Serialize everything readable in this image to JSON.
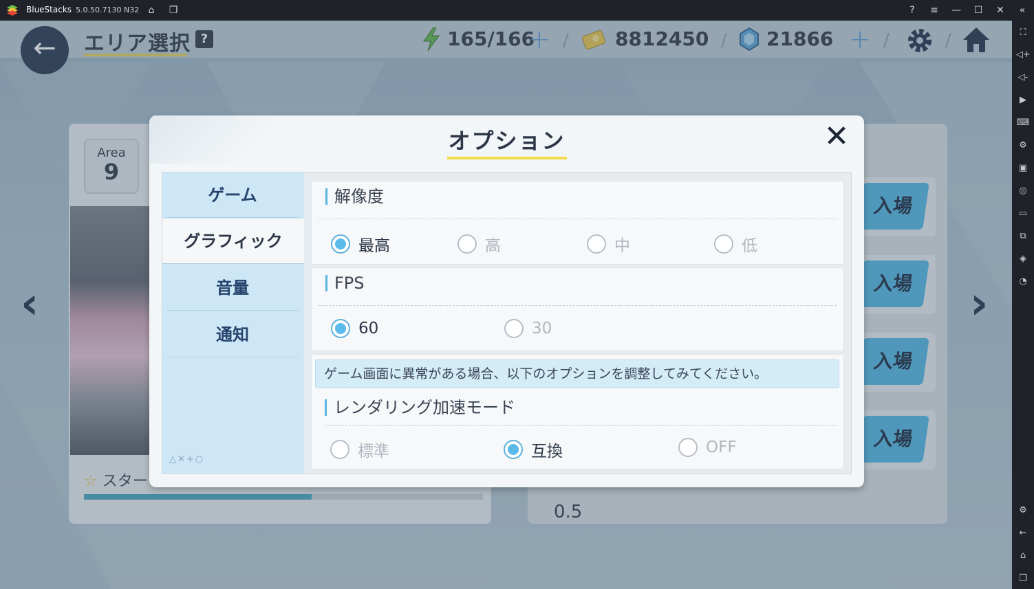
{
  "window": {
    "app_name": "BlueStacks",
    "version": "5.0.50.7130 N32"
  },
  "header": {
    "title": "エリア選択",
    "help_label": "?",
    "stamina": "165/166",
    "coins": "8812450",
    "gems": "21866"
  },
  "background": {
    "area_label": "Area",
    "area_number": "9",
    "star_label": "スター",
    "enter_label": "入場",
    "progress": 0.57,
    "bottom_number": "0.5"
  },
  "modal": {
    "title": "オプション",
    "close_label": "✕",
    "tabs": [
      {
        "label": "ゲーム"
      },
      {
        "label": "グラフィック"
      },
      {
        "label": "音量"
      },
      {
        "label": "通知"
      }
    ],
    "tabs_deco": "△✕+○",
    "sections": {
      "resolution": {
        "title": "解像度",
        "options": [
          "最高",
          "高",
          "中",
          "低"
        ],
        "selected": "最高"
      },
      "fps": {
        "title": "FPS",
        "options": [
          "60",
          "30"
        ],
        "selected": "60"
      },
      "rendering": {
        "notice": "ゲーム画面に異常がある場合、以下のオプションを調整してみてください。",
        "title": "レンダリング加速モード",
        "options": [
          "標準",
          "互換",
          "OFF"
        ],
        "selected": "互換"
      }
    }
  },
  "colors": {
    "accent_blue": "#5bbaea",
    "title_underline": "#f2dc4a",
    "tab_bg": "#cde7f7"
  }
}
